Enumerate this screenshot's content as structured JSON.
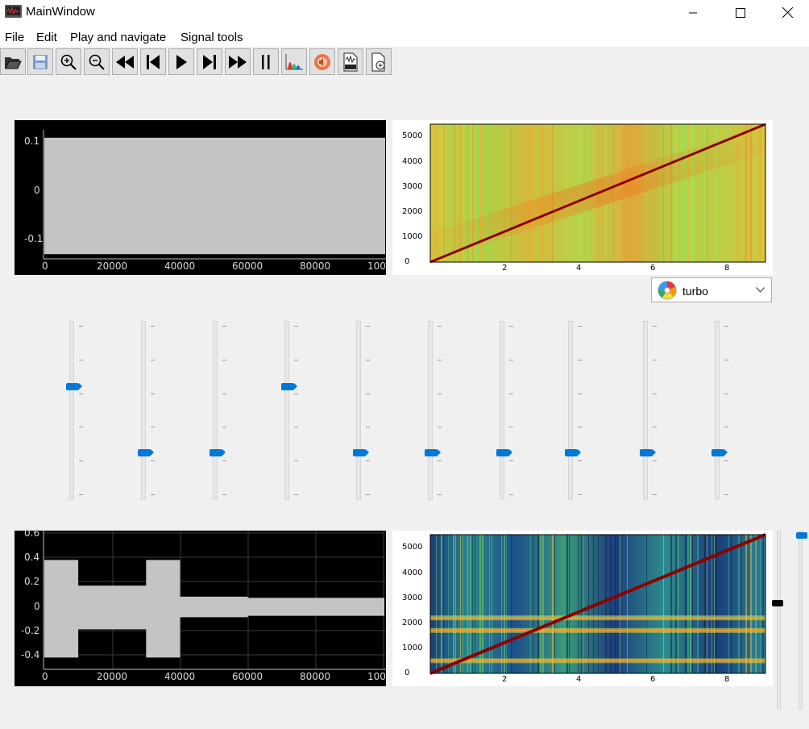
{
  "window": {
    "title": "MainWindow",
    "icon": "app-waveform-icon",
    "minimize_icon": "minimize-icon",
    "maximize_icon": "maximize-icon",
    "close_icon": "close-icon"
  },
  "menu": {
    "items": [
      "File",
      "Edit",
      "Play and navigate",
      "Signal tools"
    ]
  },
  "toolbar": {
    "buttons": [
      {
        "name": "open-file-button",
        "icon": "folder-open-icon"
      },
      {
        "name": "save-button",
        "icon": "save-icon"
      },
      {
        "name": "zoom-in-button",
        "icon": "zoom-in-icon"
      },
      {
        "name": "zoom-out-button",
        "icon": "zoom-out-icon"
      },
      {
        "name": "rewind-button",
        "icon": "rewind-icon"
      },
      {
        "name": "skip-to-start-button",
        "icon": "skip-start-icon"
      },
      {
        "name": "play-button",
        "icon": "play-icon"
      },
      {
        "name": "skip-to-end-button",
        "icon": "skip-end-icon"
      },
      {
        "name": "fast-forward-button",
        "icon": "fast-forward-icon"
      },
      {
        "name": "pause-button",
        "icon": "pause-icon"
      },
      {
        "name": "spectrogram-button",
        "icon": "spectrogram-icon"
      },
      {
        "name": "audio-button",
        "icon": "speaker-icon"
      },
      {
        "name": "export-wav-button",
        "icon": "wav-file-icon"
      },
      {
        "name": "new-file-button",
        "icon": "add-file-icon"
      }
    ]
  },
  "colormap": {
    "selected": "turbo",
    "icon": "color-palette-icon",
    "dropdown_icon": "chevron-down-icon"
  },
  "colors": {
    "plot_bg": "#000000",
    "waveform": "#c4c4c4",
    "slider_accent": "#0078d7",
    "spectro_peak": "#8b0000"
  },
  "chart_data": [
    {
      "type": "area",
      "panel": "input-waveform",
      "x": [
        0,
        20000,
        40000,
        60000,
        80000,
        100000
      ],
      "x_tick_labels": [
        "0",
        "20000",
        "40000",
        "60000",
        "80000",
        "100"
      ],
      "y_tick_labels": [
        "0.1",
        "0",
        "-0.1"
      ],
      "ylim": [
        -0.13,
        0.13
      ],
      "series": [
        {
          "values": [
            0.12,
            0.12,
            0.12,
            0.12,
            0.12,
            0.12
          ]
        }
      ],
      "grid": false
    },
    {
      "type": "heatmap",
      "panel": "input-spectrogram",
      "x_tick_labels": [
        "2",
        "4",
        "6",
        "8"
      ],
      "y_tick_labels": [
        "0",
        "1000",
        "2000",
        "3000",
        "4000",
        "5000"
      ],
      "xlim": [
        0,
        9.0
      ],
      "ylim": [
        0,
        5500
      ],
      "ridge": {
        "x": [
          0,
          9.0
        ],
        "y": [
          0,
          5500
        ]
      }
    },
    {
      "type": "area",
      "panel": "output-waveform",
      "x": [
        0,
        10000,
        20000,
        30000,
        40000,
        60000,
        80000,
        100000
      ],
      "x_tick_labels": [
        "0",
        "20000",
        "40000",
        "60000",
        "80000",
        "100"
      ],
      "y_tick_labels": [
        "0.6",
        "0.4",
        "0.2",
        "0",
        "-0.2",
        "-0.4"
      ],
      "ylim": [
        -0.5,
        0.6
      ],
      "series": [
        {
          "values": [
            0.38,
            0.17,
            0.17,
            0.38,
            0.08,
            0.07,
            0.07,
            0.07
          ]
        }
      ],
      "grid": true
    },
    {
      "type": "heatmap",
      "panel": "output-spectrogram",
      "x_tick_labels": [
        "2",
        "4",
        "6",
        "8"
      ],
      "y_tick_labels": [
        "0",
        "1000",
        "2000",
        "3000",
        "4000",
        "5000"
      ],
      "xlim": [
        0,
        9.0
      ],
      "ylim": [
        0,
        5500
      ],
      "ridge": {
        "x": [
          0,
          9.0
        ],
        "y": [
          0,
          5500
        ]
      },
      "bands_hz": [
        500,
        1700,
        2200
      ]
    }
  ],
  "equalizer": {
    "sliders": [
      {
        "value": 0.64
      },
      {
        "value": 0.25
      },
      {
        "value": 0.25
      },
      {
        "value": 0.64
      },
      {
        "value": 0.25
      },
      {
        "value": 0.25
      },
      {
        "value": 0.25
      },
      {
        "value": 0.25
      },
      {
        "value": 0.25
      },
      {
        "value": 0.25
      }
    ]
  },
  "side_sliders": [
    {
      "value": 0.6
    },
    {
      "value": 0.99
    }
  ]
}
